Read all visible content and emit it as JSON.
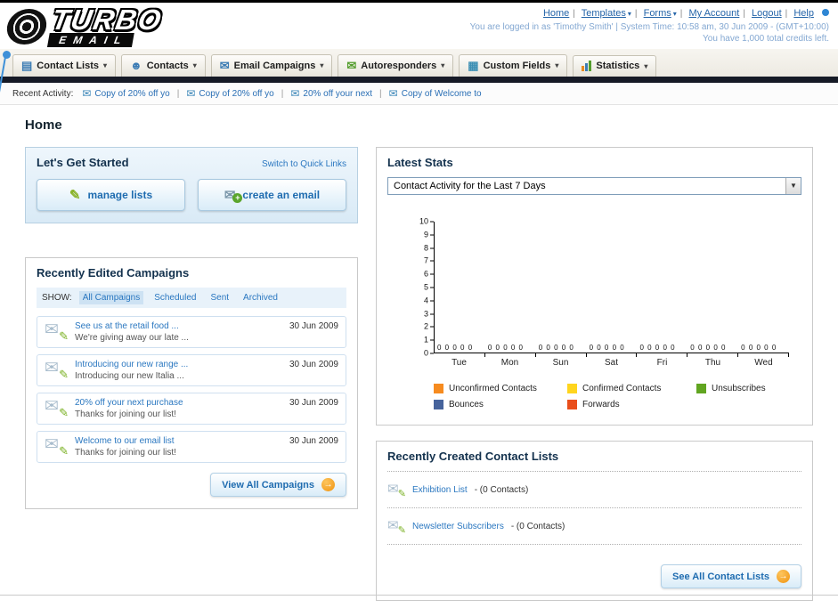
{
  "header": {
    "logo": {
      "line1": "TURBO",
      "line2": "EMAIL"
    },
    "links": [
      "Home",
      "Templates",
      "Forms",
      "My Account",
      "Logout",
      "Help"
    ],
    "login_text": "You are logged in as 'Timothy Smith' | System Time: 10:58 am, 30 Jun 2009 - (GMT+10:00)",
    "credits_text": "You have 1,000 total credits left."
  },
  "nav": {
    "tabs": [
      {
        "label": "Contact Lists"
      },
      {
        "label": "Contacts"
      },
      {
        "label": "Email Campaigns"
      },
      {
        "label": "Autoresponders"
      },
      {
        "label": "Custom Fields"
      },
      {
        "label": "Statistics"
      }
    ]
  },
  "recent_activity": {
    "label": "Recent Activity:",
    "items": [
      "Copy of 20% off yo",
      "Copy of 20% off yo",
      "20% off your next",
      "Copy of Welcome to"
    ]
  },
  "main": {
    "page_title": "Home",
    "get_started": {
      "title": "Let's Get Started",
      "switch_link": "Switch to Quick Links",
      "manage_lists_label": "manage lists",
      "create_email_label": "create an email"
    },
    "campaigns": {
      "title": "Recently Edited Campaigns",
      "show_label": "SHOW:",
      "filters": [
        "All Campaigns",
        "Scheduled",
        "Sent",
        "Archived"
      ],
      "active_filter": "All Campaigns",
      "items": [
        {
          "title": "See us at the retail food ...",
          "desc": "We're giving away our late ...",
          "date": "30 Jun 2009"
        },
        {
          "title": "Introducing our new range ...",
          "desc": "Introducing our new Italia ...",
          "date": "30 Jun 2009"
        },
        {
          "title": "20% off your next purchase",
          "desc": "Thanks for joining our list!",
          "date": "30 Jun 2009"
        },
        {
          "title": "Welcome to our email list",
          "desc": "Thanks for joining our list!",
          "date": "30 Jun 2009"
        }
      ],
      "view_all_label": "View All Campaigns"
    },
    "stats": {
      "title": "Latest Stats",
      "dropdown_value": "Contact Activity for the Last 7 Days"
    },
    "contact_lists": {
      "title": "Recently Created Contact Lists",
      "items": [
        {
          "name": "Exhibition List",
          "detail": "- (0 Contacts)"
        },
        {
          "name": "Newsletter Subscribers",
          "detail": "- (0 Contacts)"
        }
      ],
      "see_all_label": "See All Contact Lists"
    }
  },
  "chart_data": {
    "type": "bar",
    "title": "Contact Activity for the Last 7 Days",
    "categories": [
      "Tue",
      "Mon",
      "Sun",
      "Sat",
      "Fri",
      "Thu",
      "Wed"
    ],
    "series": [
      {
        "name": "Unconfirmed Contacts",
        "color": "#f68b1f",
        "values": [
          0,
          0,
          0,
          0,
          0,
          0,
          0
        ]
      },
      {
        "name": "Confirmed Contacts",
        "color": "#ffd51e",
        "values": [
          0,
          0,
          0,
          0,
          0,
          0,
          0
        ]
      },
      {
        "name": "Unsubscribes",
        "color": "#61a521",
        "values": [
          0,
          0,
          0,
          0,
          0,
          0,
          0
        ]
      },
      {
        "name": "Bounces",
        "color": "#46639c",
        "values": [
          0,
          0,
          0,
          0,
          0,
          0,
          0
        ]
      },
      {
        "name": "Forwards",
        "color": "#e94e1b",
        "values": [
          0,
          0,
          0,
          0,
          0,
          0,
          0
        ]
      }
    ],
    "ylim": [
      0,
      10
    ],
    "ytick_step": 1,
    "grid": false,
    "legend_position": "bottom"
  }
}
